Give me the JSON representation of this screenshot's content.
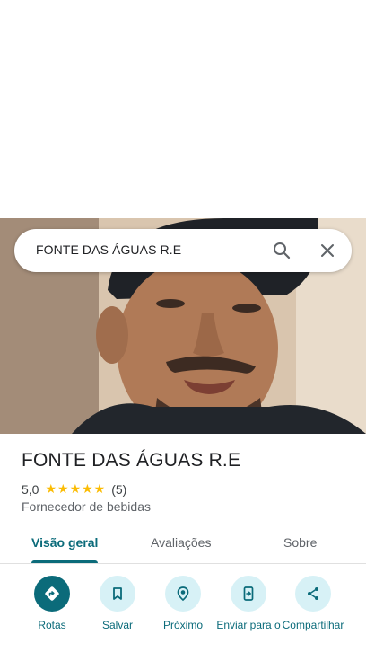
{
  "search": {
    "query": "FONTE DAS ÁGUAS R.E",
    "search_icon": "search-icon",
    "close_icon": "close-icon"
  },
  "hero_image": {
    "description": "photo-of-person"
  },
  "place": {
    "name": "FONTE DAS ÁGUAS R.E",
    "rating": "5,0",
    "stars": "★★★★★",
    "review_count": "(5)",
    "category": "Fornecedor de bebidas"
  },
  "tabs": [
    {
      "label": "Visão geral",
      "active": true
    },
    {
      "label": "Avaliações",
      "active": false
    },
    {
      "label": "Sobre",
      "active": false
    }
  ],
  "actions": [
    {
      "label": "Rotas",
      "icon": "directions-icon"
    },
    {
      "label": "Salvar",
      "icon": "bookmark-icon"
    },
    {
      "label": "Próximo",
      "icon": "nearby-icon"
    },
    {
      "label": "Enviar para o",
      "icon": "send-to-phone-icon"
    },
    {
      "label": "Compartilhar",
      "icon": "share-icon"
    }
  ],
  "colors": {
    "accent": "#0b6b7a",
    "accent_light": "#d7f1f6",
    "star": "#fbbc04"
  }
}
